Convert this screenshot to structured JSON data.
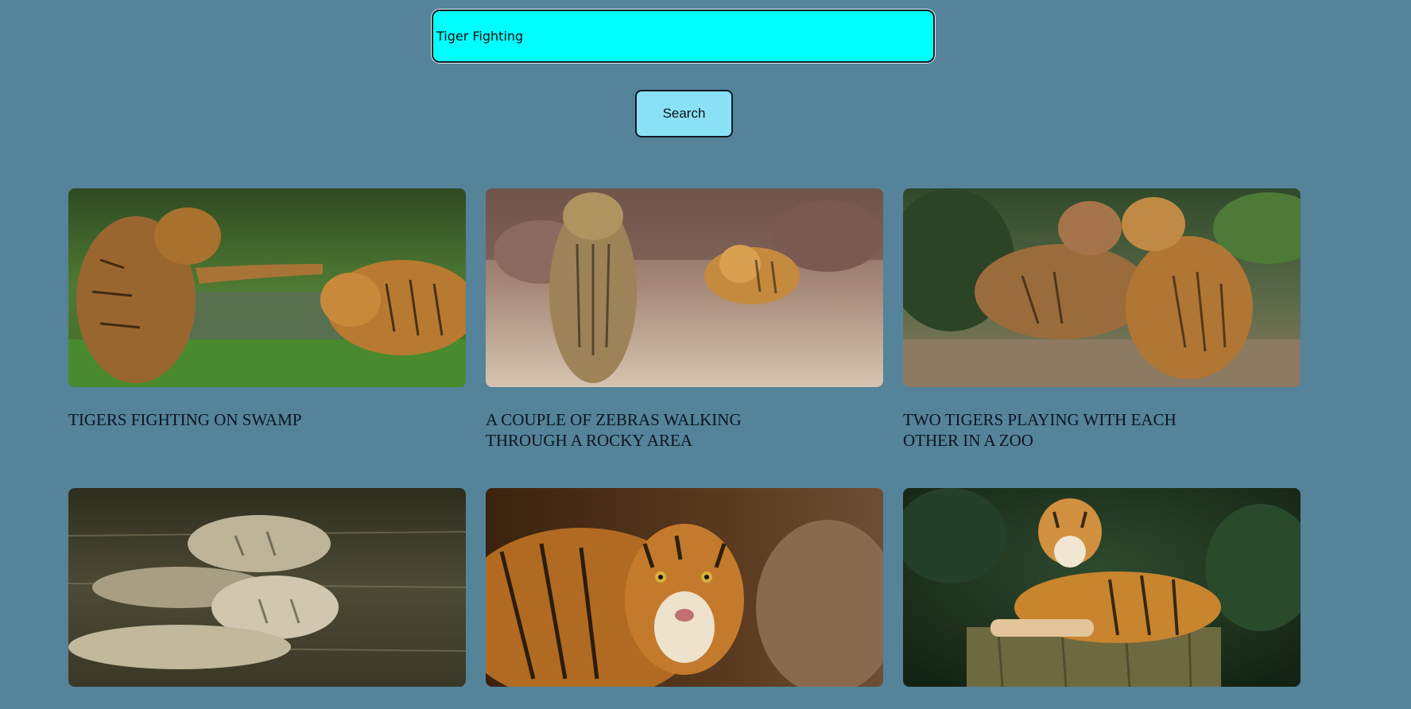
{
  "search": {
    "value": "Tiger Fighting",
    "button_label": "Search"
  },
  "results": [
    {
      "title": "TIGERS FIGHTING ON SWAMP",
      "image": "two-tigers-swamp-photo"
    },
    {
      "title": "A COUPLE OF ZEBRAS WALKING THROUGH A ROCKY AREA",
      "image": "tigers-rocky-area-photo"
    },
    {
      "title": "TWO TIGERS PLAYING WITH EACH OTHER IN A ZOO",
      "image": "tigers-playing-zoo-photo"
    },
    {
      "title": "",
      "image": "tigers-swimming-water-photo"
    },
    {
      "title": "",
      "image": "tiger-closeup-photo"
    },
    {
      "title": "",
      "image": "tiger-on-stump-photo"
    }
  ],
  "colors": {
    "background": "#54839a",
    "input_background": "#00ffff",
    "button_background": "#8ae1f6"
  }
}
